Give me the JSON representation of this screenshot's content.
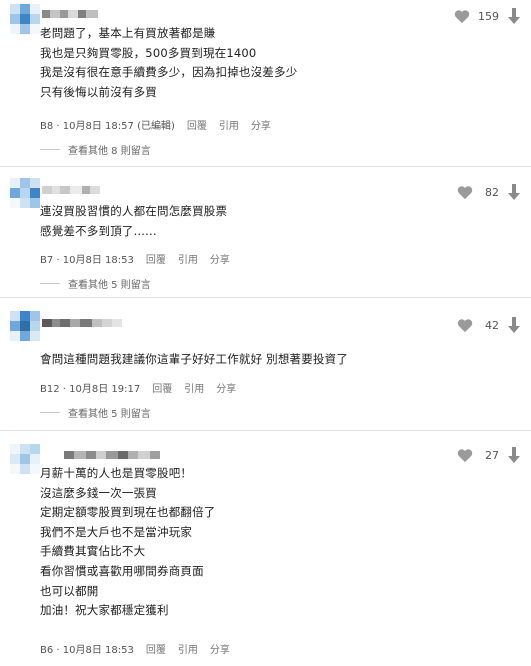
{
  "comments": [
    {
      "likes": "159",
      "lines": [
        "老問題了，基本上有買放著都是賺",
        "我也是只夠買零股，500多買到現在1400",
        "我是沒有很在意手續費多少，因為扣掉也沒差多少",
        "只有後悔以前沒有多買"
      ],
      "floor": "B8",
      "time": "10月8日 18:57",
      "edited": "(已編輯)",
      "reply": "回覆",
      "quote": "引用",
      "share": "分享",
      "more": "查看其他 8 則留言"
    },
    {
      "likes": "82",
      "lines": [
        "連沒買股習慣的人都在問怎麼買股票",
        "感覺差不多到頂了......"
      ],
      "floor": "B7",
      "time": "10月8日 18:53",
      "reply": "回覆",
      "quote": "引用",
      "share": "分享",
      "more": "查看其他 5 則留言"
    },
    {
      "likes": "42",
      "lines": [
        "會問這種問題我建議你這輩子好好工作就好 別想著要投資了"
      ],
      "floor": "B12",
      "time": "10月8日 19:17",
      "reply": "回覆",
      "quote": "引用",
      "share": "分享",
      "more": "查看其他 5 則留言"
    },
    {
      "likes": "27",
      "lines": [
        "月薪十萬的人也是買零股吧！",
        "沒這麼多錢一次一張買",
        "定期定額零股買到現在也都翻倍了",
        "我們不是大戶也不是當沖玩家",
        "手續費其實佔比不大",
        "看你習慣或喜歡用哪間券商頁面",
        "也可以都開",
        "加油！祝大家都穩定獲利"
      ],
      "floor": "B6",
      "time": "10月8日 18:53",
      "reply": "回覆",
      "quote": "引用",
      "share": "分享"
    }
  ],
  "colors": {
    "heart": "#9a9a9a",
    "arrow": "#8a8a8a",
    "avatar_palette": [
      "#6fa8dc",
      "#9fc5e8",
      "#cfe2f3",
      "#3d85c6",
      "#b7d7ee"
    ]
  }
}
